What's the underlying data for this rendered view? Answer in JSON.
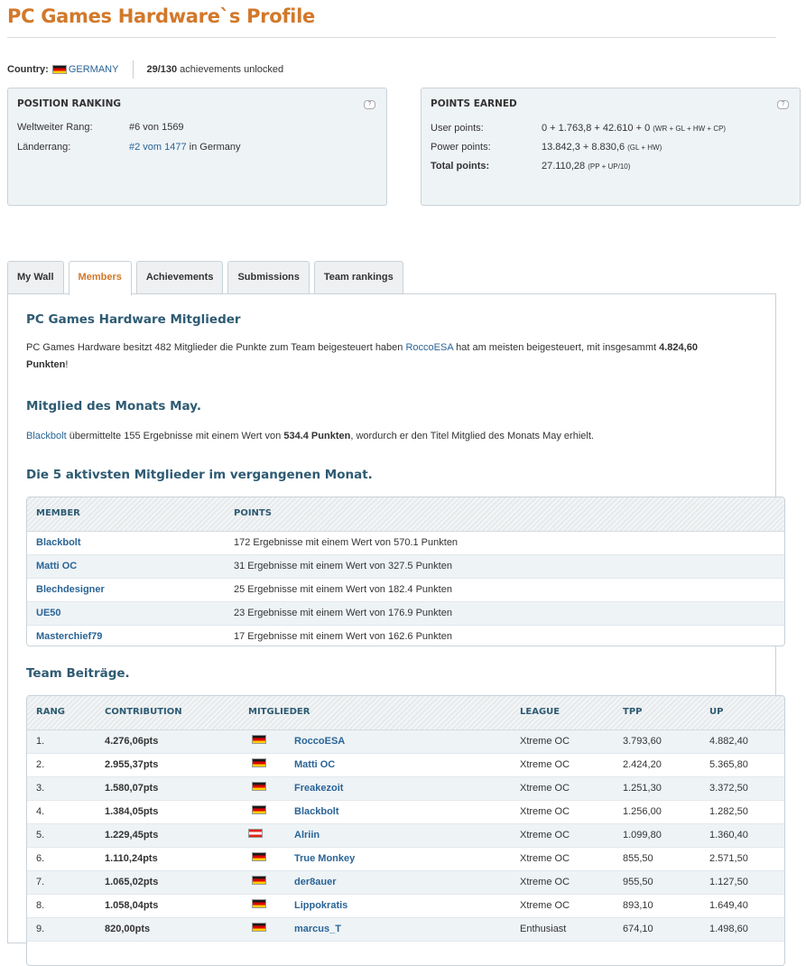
{
  "page": {
    "title": "PC Games Hardware`s Profile",
    "country_label": "Country:",
    "country": "GERMANY",
    "achievements_count": "29/130",
    "achievements_text": "achievements unlocked"
  },
  "position_ranking": {
    "heading": "POSITION RANKING",
    "help": "?",
    "worldwide_label": "Weltweiter Rang:",
    "worldwide_value": "#6 von 1569",
    "country_label": "Länderrang:",
    "country_value": "#2 vom 1477",
    "country_suffix": "in Germany"
  },
  "points_earned": {
    "heading": "POINTS EARNED",
    "help": "?",
    "user_label": "User points:",
    "user_value": "0 + 1.763,8 + 42.610 + 0",
    "user_note": "(WR + GL + HW + CP)",
    "power_label": "Power points:",
    "power_value": "13.842,3 + 8.830,6",
    "power_note": "(GL + HW)",
    "total_label": "Total points:",
    "total_value": "27.110,28",
    "total_note": "(PP + UP/10)"
  },
  "tabs": [
    {
      "label": "My Wall"
    },
    {
      "label": "Members"
    },
    {
      "label": "Achievements"
    },
    {
      "label": "Submissions"
    },
    {
      "label": "Team rankings"
    }
  ],
  "members": {
    "heading": "PC Games Hardware Mitglieder",
    "intro_part1": "PC Games Hardware besitzt 482 Mitglieder die Punkte zum Team beigesteuert haben",
    "intro_user": "RoccoESA",
    "intro_part2": "hat am meisten beigesteuert, mit insgesammt",
    "intro_points": "4.824,60",
    "intro_points_word": "Punkten",
    "intro_end": "!"
  },
  "motm": {
    "heading": "Mitglied des Monats May.",
    "user": "Blackbolt",
    "text1": "übermittelte 155 Ergebnisse mit einem Wert von",
    "points": "534.4 Punkten",
    "text2": ", wordurch er den Titel Mitglied des Monats May erhielt."
  },
  "top5": {
    "heading": "Die 5 aktivsten Mitglieder im vergangenen Monat.",
    "col_member": "MEMBER",
    "col_points": "POINTS",
    "rows": [
      {
        "member": "Blackbolt",
        "points": "172 Ergebnisse mit einem Wert von 570.1 Punkten"
      },
      {
        "member": "Matti OC",
        "points": "31 Ergebnisse mit einem Wert von 327.5 Punkten"
      },
      {
        "member": "Blechdesigner",
        "points": "25 Ergebnisse mit einem Wert von 182.4 Punkten"
      },
      {
        "member": "UE50",
        "points": "23 Ergebnisse mit einem Wert von 176.9 Punkten"
      },
      {
        "member": "Masterchief79",
        "points": "17 Ergebnisse mit einem Wert von 162.6 Punkten"
      }
    ]
  },
  "team": {
    "heading": "Team Beiträge.",
    "col_rank": "RANG",
    "col_contribution": "CONTRIBUTION",
    "col_members": "MITGLIEDER",
    "col_league": "LEAGUE",
    "col_tpp": "TPP",
    "col_up": "UP",
    "rows": [
      {
        "rank": "1.",
        "contribution": "4.276,06pts",
        "flag": "de",
        "member": "RoccoESA",
        "league": "Xtreme OC",
        "tpp": "3.793,60",
        "up": "4.882,40"
      },
      {
        "rank": "2.",
        "contribution": "2.955,37pts",
        "flag": "de",
        "member": "Matti OC",
        "league": "Xtreme OC",
        "tpp": "2.424,20",
        "up": "5.365,80"
      },
      {
        "rank": "3.",
        "contribution": "1.580,07pts",
        "flag": "de",
        "member": "Freakezoit",
        "league": "Xtreme OC",
        "tpp": "1.251,30",
        "up": "3.372,50"
      },
      {
        "rank": "4.",
        "contribution": "1.384,05pts",
        "flag": "de",
        "member": "Blackbolt",
        "league": "Xtreme OC",
        "tpp": "1.256,00",
        "up": "1.282,50"
      },
      {
        "rank": "5.",
        "contribution": "1.229,45pts",
        "flag": "at",
        "member": "Alriin",
        "league": "Xtreme OC",
        "tpp": "1.099,80",
        "up": "1.360,40"
      },
      {
        "rank": "6.",
        "contribution": "1.110,24pts",
        "flag": "de",
        "member": "True Monkey",
        "league": "Xtreme OC",
        "tpp": "855,50",
        "up": "2.571,50"
      },
      {
        "rank": "7.",
        "contribution": "1.065,02pts",
        "flag": "de",
        "member": "der8auer",
        "league": "Xtreme OC",
        "tpp": "955,50",
        "up": "1.127,50"
      },
      {
        "rank": "8.",
        "contribution": "1.058,04pts",
        "flag": "de",
        "member": "Lippokratis",
        "league": "Xtreme OC",
        "tpp": "893,10",
        "up": "1.649,40"
      },
      {
        "rank": "9.",
        "contribution": "820,00pts",
        "flag": "de",
        "member": "marcus_T",
        "league": "Enthusiast",
        "tpp": "674,10",
        "up": "1.498,60"
      }
    ]
  }
}
